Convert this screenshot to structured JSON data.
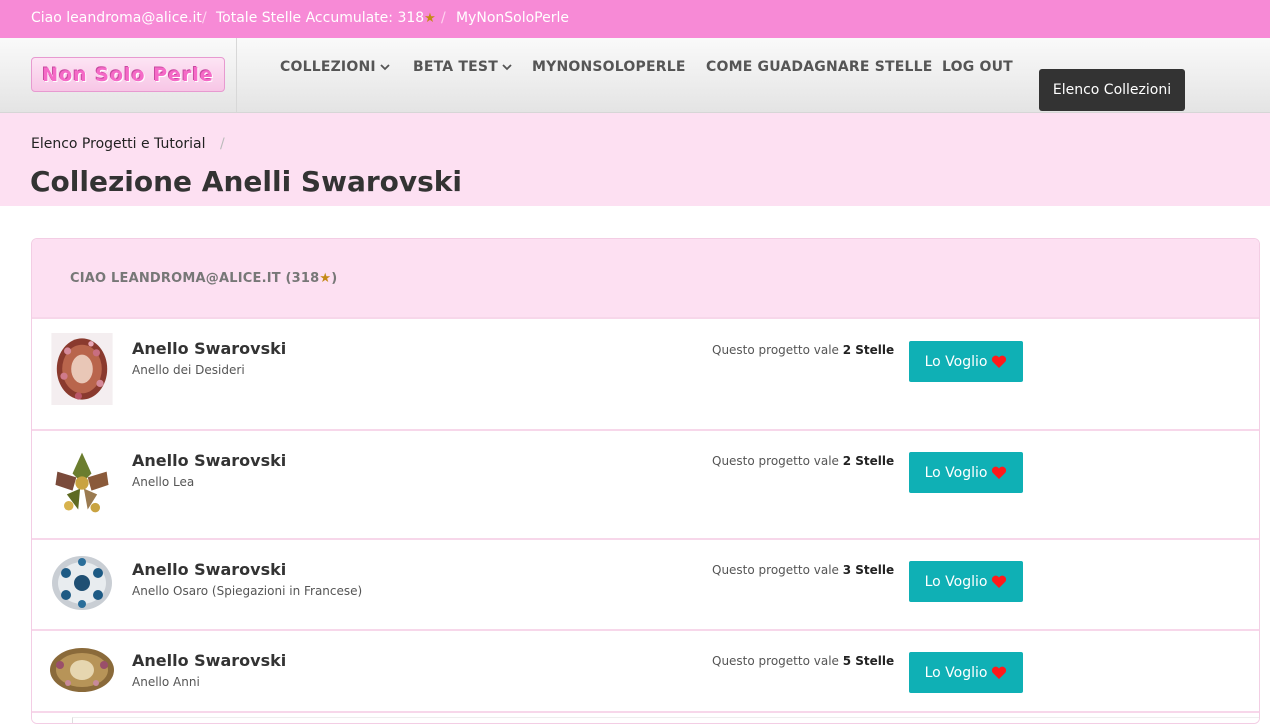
{
  "topbar": {
    "greeting": "Ciao leandroma@alice.it",
    "sep": "/",
    "stars_label": "Totale Stelle Accumulate: 318",
    "star_glyph": "★",
    "mynonsoloperle": "MyNonSoloPerle"
  },
  "header": {
    "logo_text": "Non Solo Perle",
    "nav": [
      {
        "label": "COLLEZIONI",
        "dropdown": true
      },
      {
        "label": "BETA TEST",
        "dropdown": true
      },
      {
        "label": "MYNONSOLOPERLE",
        "dropdown": false
      },
      {
        "label": "COME GUADAGNARE STELLE",
        "dropdown": false
      },
      {
        "label": "LOG OUT",
        "dropdown": false
      }
    ],
    "chevron": "",
    "collections_button": "Elenco Collezioni"
  },
  "page": {
    "breadcrumb": "Elenco Progetti e Tutorial",
    "breadcrumb_sep": "/",
    "title": "Collezione Anelli Swarovski"
  },
  "panel": {
    "heading": "CIAO LEANDROMA@ALICE.IT (318",
    "heading_star": "★",
    "heading_close": ")"
  },
  "items": [
    {
      "title": "Anello Swarovski",
      "subtitle": "Anello dei Desideri",
      "value_prefix": "Questo progetto vale",
      "stars": "2 Stelle",
      "button": "Lo Voglio"
    },
    {
      "title": "Anello Swarovski",
      "subtitle": "Anello Lea",
      "value_prefix": "Questo progetto vale",
      "stars": "2 Stelle",
      "button": "Lo Voglio"
    },
    {
      "title": "Anello Swarovski",
      "subtitle": "Anello Osaro (Spiegazioni in Francese)",
      "value_prefix": "Questo progetto vale",
      "stars": "3 Stelle",
      "button": "Lo Voglio"
    },
    {
      "title": "Anello Swarovski",
      "subtitle": "Anello Anni",
      "value_prefix": "Questo progetto vale",
      "stars": "5 Stelle",
      "button": "Lo Voglio"
    }
  ],
  "colors": {
    "topbar": "#f78ad6",
    "band": "#fde0f2",
    "button": "#0fb0b5",
    "heart": "#ff1a1a"
  }
}
